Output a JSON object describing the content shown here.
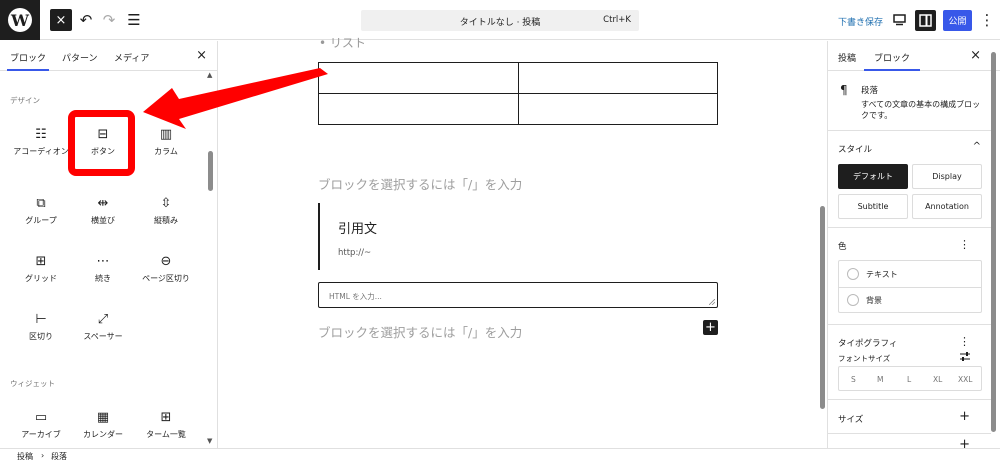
{
  "topbar": {
    "logo_letter": "W",
    "close_icon": "×",
    "undo_icon": "↶",
    "redo_icon": "↷",
    "list_view_icon": "☰",
    "title": "タイトルなし · 投稿",
    "shortcut": "Ctrl+K",
    "save_draft": "下書き保存",
    "preview_icon": "desktop-icon",
    "settings_icon": "sidebar-icon",
    "publish": "公開",
    "more_icon": "⋮"
  },
  "inserter": {
    "tabs": [
      "ブロック",
      "パターン",
      "メディア"
    ],
    "close": "×",
    "category_design": "デザイン",
    "category_widgets": "ウィジェット",
    "blocks": [
      {
        "label": "アコーディオン",
        "icon": "☷"
      },
      {
        "label": "ボタン",
        "icon": "⊟"
      },
      {
        "label": "カラム",
        "icon": "▥"
      },
      {
        "label": "グループ",
        "icon": "⧉"
      },
      {
        "label": "横並び",
        "icon": "⇹"
      },
      {
        "label": "縦積み",
        "icon": "⇳"
      },
      {
        "label": "グリッド",
        "icon": "⊞"
      },
      {
        "label": "続き",
        "icon": "⋯"
      },
      {
        "label": "ページ区切り",
        "icon": "⊖"
      },
      {
        "label": "区切り",
        "icon": "⊢"
      },
      {
        "label": "スペーサー",
        "icon": "⤢"
      }
    ],
    "widgets": [
      {
        "label": "アーカイブ",
        "icon": "▭"
      },
      {
        "label": "カレンダー",
        "icon": "▦"
      },
      {
        "label": "ターム一覧",
        "icon": "⊞"
      }
    ]
  },
  "canvas": {
    "list_item": "• リスト",
    "placeholder_1": "ブロックを選択するには「/」を入力",
    "quote_text": "引用文",
    "quote_citation": "http://~",
    "html_placeholder": "HTML を入力...",
    "placeholder_2": "ブロックを選択するには「/」を入力",
    "add_block": "+"
  },
  "sidebar": {
    "tabs": [
      "投稿",
      "ブロック"
    ],
    "close": "×",
    "block_icon": "¶",
    "block_name": "段落",
    "block_description": "すべての文章の基本の構成ブロックです。",
    "style_title": "スタイル",
    "style_collapse_icon": "^",
    "styles": [
      "デフォルト",
      "Display",
      "Subtitle",
      "Annotation"
    ],
    "color_title": "色",
    "color_items": [
      "テキスト",
      "背景"
    ],
    "typography_title": "タイポグラフィ",
    "font_size_label": "フォントサイズ",
    "font_sizes": [
      "S",
      "M",
      "L",
      "XL",
      "XXL"
    ],
    "size_title": "サイズ",
    "add_icon": "+",
    "kebab_icon": "⋮"
  },
  "footer": {
    "crumb_1": "投稿",
    "separator": "›",
    "crumb_2": "段落"
  },
  "colors": {
    "accent": "#3858e9",
    "highlight": "#ff0000",
    "link": "#2271b1"
  }
}
